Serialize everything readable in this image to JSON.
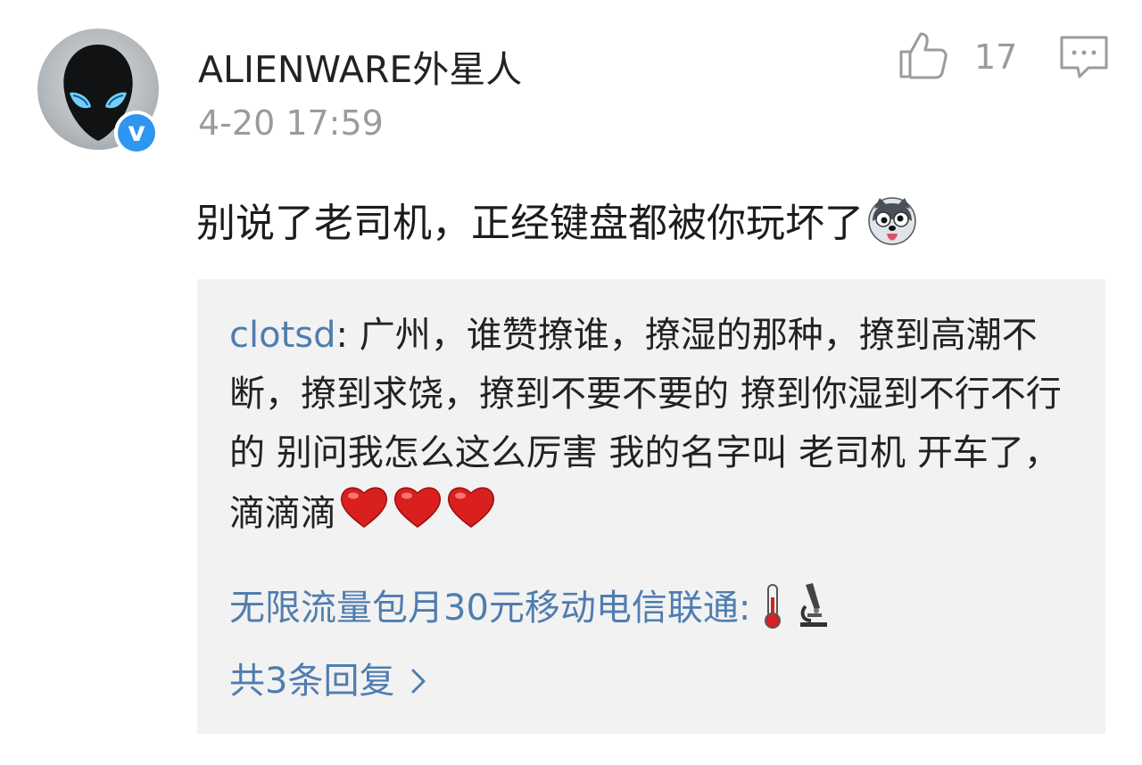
{
  "comment": {
    "author": "ALIENWARE外星人",
    "timestamp": "4-20 17:59",
    "like_count": "17",
    "text": "别说了老司机，正经键盘都被你玩坏了",
    "text_emoji": "husky-emoji",
    "avatar_icon": "alien-head-icon",
    "verified_icon": "verified-badge-icon",
    "verified_badge_letter": "v"
  },
  "replies": [
    {
      "author": "clotsd",
      "separator": ": ",
      "text": "广州，谁赞撩谁，撩湿的那种，撩到高潮不断，撩到求饶，撩到不要不要的 撩到你湿到不行不行的 别问我怎么这么厉害 我的名字叫 老司机 开车了，滴滴滴",
      "emojis": [
        "heart-emoji",
        "heart-emoji",
        "heart-emoji"
      ]
    },
    {
      "author": "无限流量包月30元移动电信联通",
      "separator": ":",
      "emojis": [
        "thermometer-emoji",
        "microscope-emoji"
      ]
    }
  ],
  "more_replies": {
    "label": "共3条回复",
    "icon": "chevron-right-icon"
  },
  "colors": {
    "link": "#507daf",
    "meta": "#9b9b9b",
    "reply_bg": "#f2f2f2",
    "verified": "#2d96f0"
  }
}
